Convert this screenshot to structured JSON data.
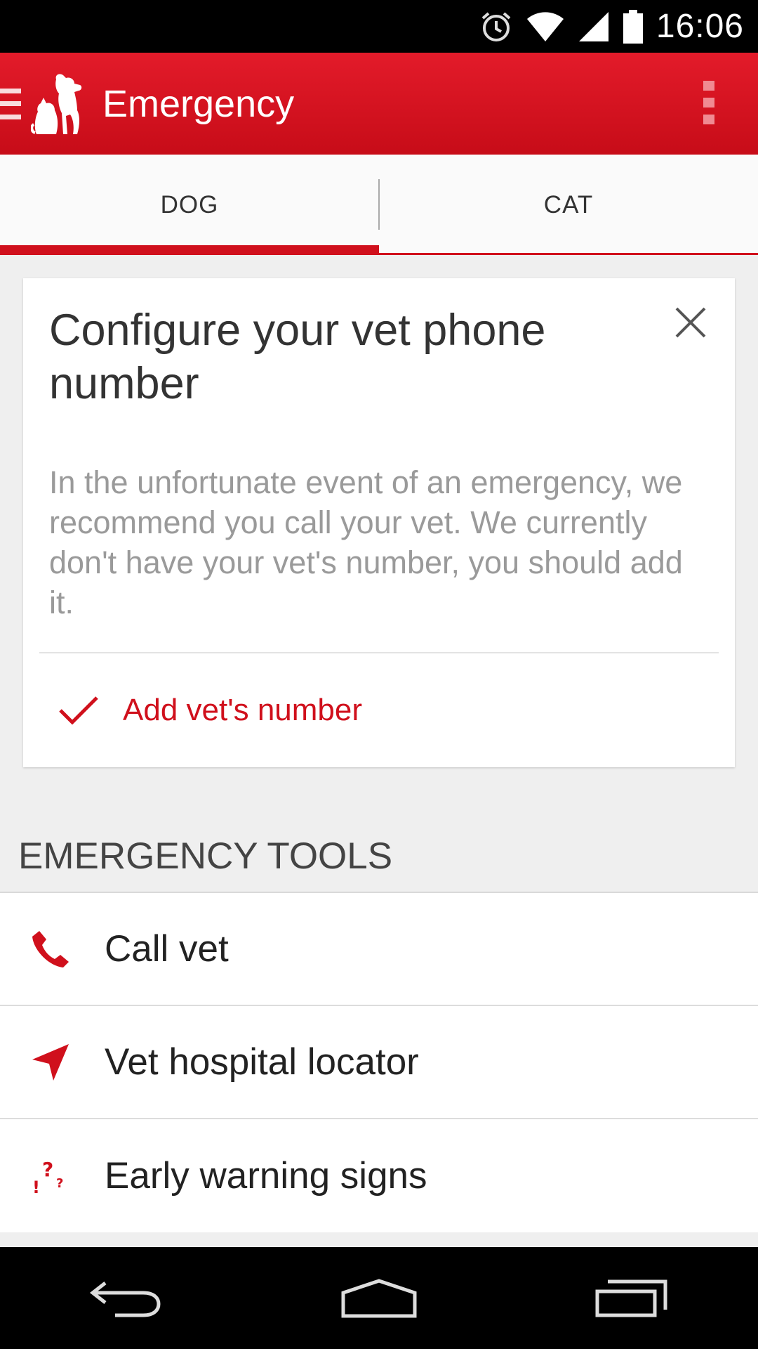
{
  "status_bar": {
    "time": "16:06",
    "icons": [
      "alarm-icon",
      "wifi-icon",
      "signal-icon",
      "battery-icon"
    ]
  },
  "app_bar": {
    "title": "Emergency",
    "icons": [
      "drawer-icon",
      "pet-logo-icon",
      "overflow-menu-icon"
    ]
  },
  "tabs": [
    {
      "label": "DOG",
      "active": true
    },
    {
      "label": "CAT",
      "active": false
    }
  ],
  "card": {
    "title": "Configure your vet phone number",
    "body": "In the unfortunate event of an emergency, we recommend you call your vet. We currently don't have your vet's number, you should add it.",
    "action_label": "Add vet's number",
    "icons": [
      "close-icon",
      "check-icon"
    ]
  },
  "section": {
    "header": "EMERGENCY TOOLS",
    "items": [
      {
        "label": "Call vet",
        "icon": "phone-icon"
      },
      {
        "label": "Vet hospital locator",
        "icon": "navigation-arrow-icon"
      },
      {
        "label": "Early warning signs",
        "icon": "question-exclamation-icon"
      }
    ]
  },
  "nav_bar": {
    "icons": [
      "back-icon",
      "home-icon",
      "recents-icon"
    ]
  },
  "colors": {
    "accent": "#d0101c",
    "app_bar": "#e31b2a",
    "background": "#efefef"
  }
}
